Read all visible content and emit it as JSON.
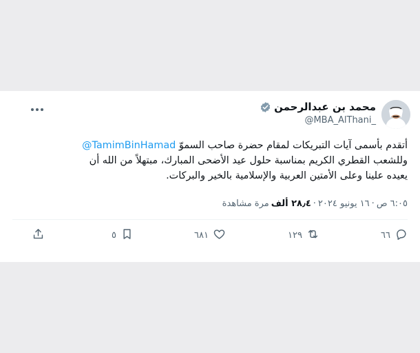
{
  "author": {
    "display_name": "محمد بن عبدالرحمن",
    "handle": "@MBA_AlThani_"
  },
  "tweet": {
    "mention": "@TamimBinHamad",
    "line1_before": "أتقدم بأسمى آيات التبريكات لمقام حضرة صاحب السموّ ",
    "line2": "وللشعب القطري الكريم بمناسبة حلول عيد الأضحى المبارك، مبتهلاً من الله أن",
    "line3": "يعيده علينا وعلى الأمتين العربية والإسلامية بالخير والبركات."
  },
  "meta": {
    "time": "٦:٠٥ ص",
    "sep1": "·",
    "date": "١٦ يونيو ٢٠٢٤",
    "sep2": "·",
    "views_count": "٢٨٫٤ ألف",
    "views_label": "مرة مشاهدة"
  },
  "actions": {
    "replies": "٦٦",
    "retweets": "١٢٩",
    "likes": "٦٨١",
    "bookmarks": "٥"
  },
  "icons": {
    "more": "more-icon",
    "verified": "verified-badge-icon",
    "reply": "reply-icon",
    "retweet": "retweet-icon",
    "like": "heart-icon",
    "bookmark": "bookmark-icon",
    "share": "share-icon"
  },
  "colors": {
    "mention": "#1d9bf0",
    "muted": "#536471",
    "text": "#0f1419",
    "background": "#ececee",
    "card": "#ffffff"
  }
}
